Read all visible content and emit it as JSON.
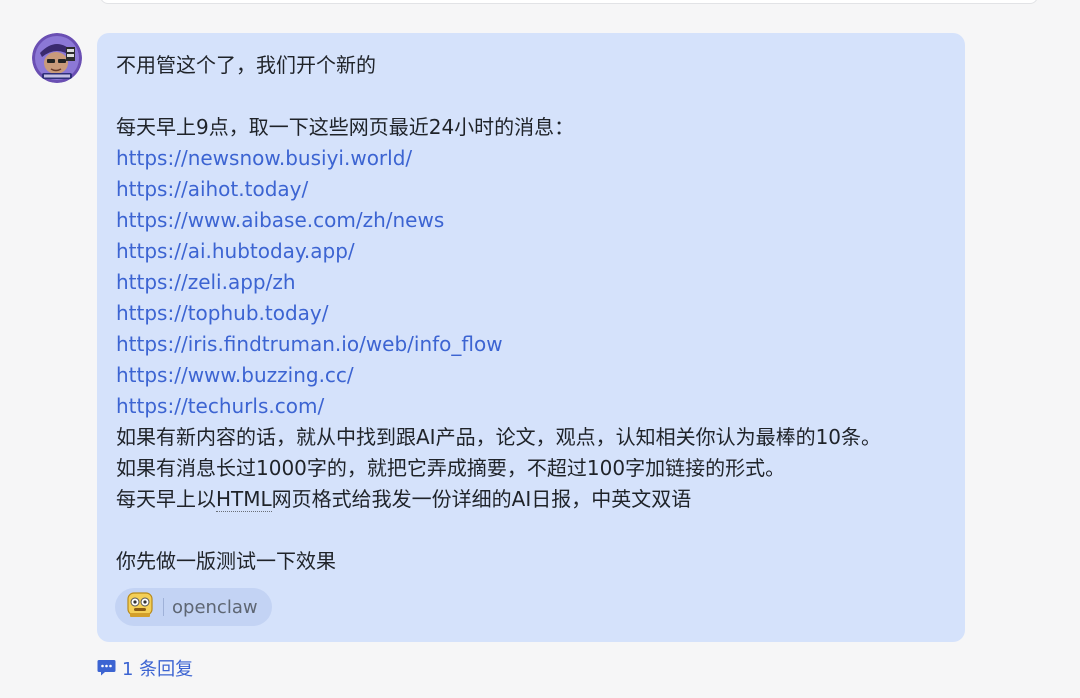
{
  "message": {
    "lines": [
      "不用管这个了，我们开个新的",
      "",
      "每天早上9点，取一下这些网页最近24小时的消息："
    ],
    "links": [
      "https://newsnow.busiyi.world/",
      "https://aihot.today/",
      "https://www.aibase.com/zh/news",
      "https://ai.hubtoday.app/",
      "https://zeli.app/zh",
      "https://tophub.today/",
      "https://iris.findtruman.io/web/info_flow",
      "https://www.buzzing.cc/",
      "https://techurls.com/"
    ],
    "after_links": [
      "如果有新内容的话，就从中找到跟AI产品，论文，观点，认知相关你认为最棒的10条。",
      "如果有消息长过1000字的，就把它弄成摘要，不超过100字加链接的形式。"
    ],
    "html_line": {
      "before": "每天早上以",
      "highlight": "HTML",
      "after": "网页格式给我发一份详细的AI日报，中英文双语"
    },
    "closing": "你先做一版测试一下效果"
  },
  "mention_chip": {
    "icon": "robot-face-icon",
    "label": "openclaw"
  },
  "reply_link": {
    "icon": "chat-bubble-icon",
    "label": "1 条回复"
  },
  "colors": {
    "bubble": "#d5e2fb",
    "link": "#3c64d2",
    "text": "#1f2329"
  }
}
